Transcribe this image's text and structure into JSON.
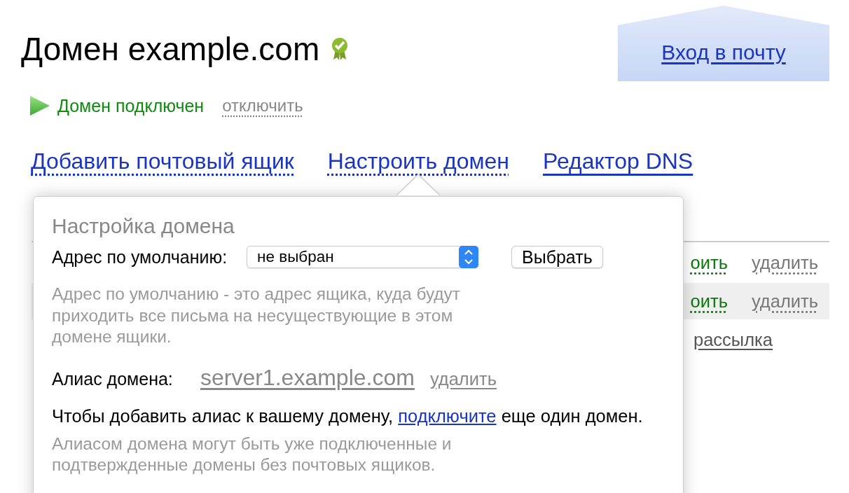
{
  "header": {
    "title": "Домен example.com",
    "verified": true,
    "mail_login": "Вход в почту"
  },
  "status": {
    "text": "Домен подключен",
    "action": "отключить"
  },
  "tabs": [
    {
      "label": "Добавить почтовый ящик",
      "kind": "dotted",
      "selected": false
    },
    {
      "label": "Настроить домен",
      "kind": "dotted",
      "selected": true
    },
    {
      "label": "Редактор DNS",
      "kind": "link",
      "selected": false
    }
  ],
  "table": {
    "rows": [
      {
        "kind": "actions",
        "cells": [
          "оить",
          "удалить"
        ],
        "shaded": false
      },
      {
        "kind": "actions",
        "cells": [
          "оить",
          "удалить"
        ],
        "shaded": true
      },
      {
        "kind": "link",
        "cells": [
          "рассылка"
        ],
        "shaded": false
      }
    ]
  },
  "popover": {
    "title": "Настройка домена",
    "default_address": {
      "label": "Адрес по умолчанию:",
      "value": "не выбран",
      "button": "Выбрать"
    },
    "default_hint": "Адрес по умолчанию - это адрес ящика, куда будут приходить все письма на несуществующие в этом домене ящики.",
    "alias": {
      "label": "Алиас домена:",
      "value": "server1.example.com",
      "remove": "удалить"
    },
    "add_alias": {
      "before": "Чтобы добавить алиас к вашему домену,",
      "link": "подключите",
      "after": "еще один домен."
    },
    "alias_hint": "Алиасом домена могут быть уже подключенные и подтвержденные домены без почтовых ящиков."
  }
}
